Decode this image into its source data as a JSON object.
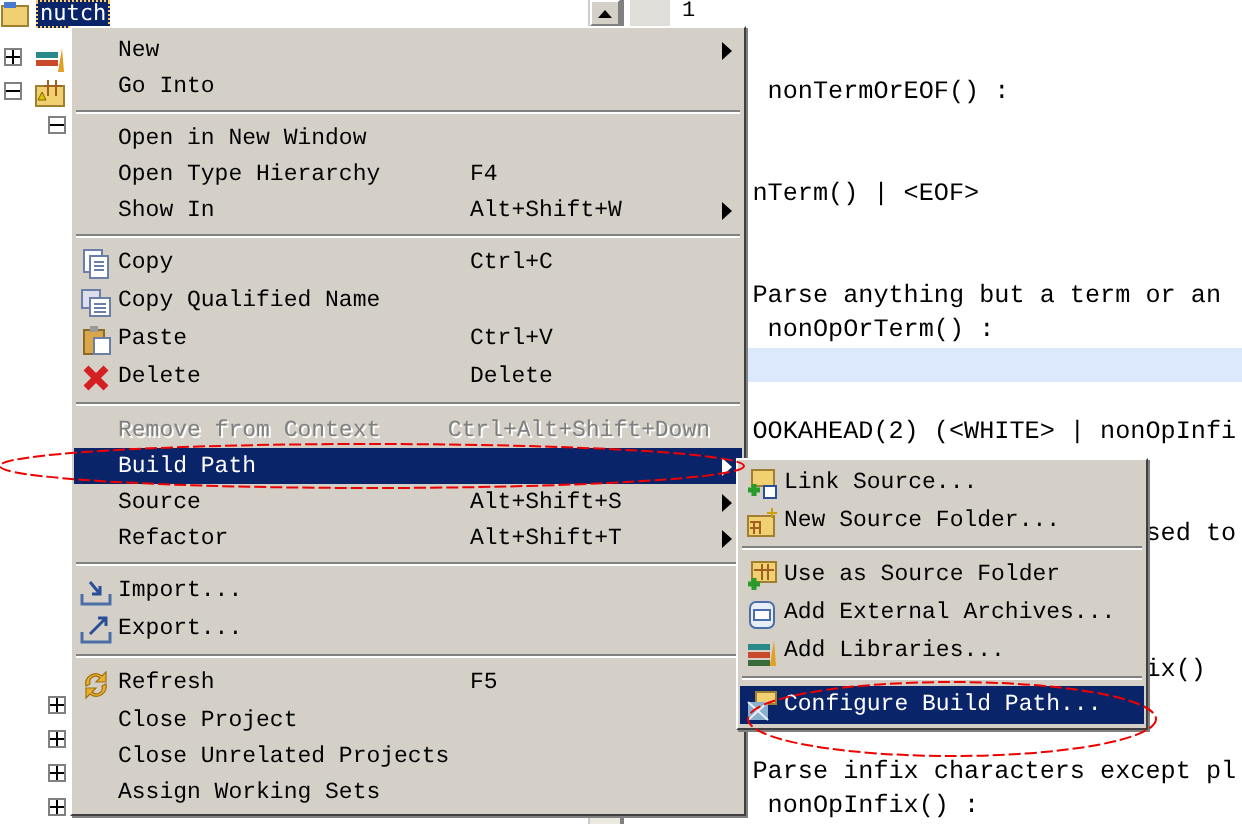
{
  "tree": {
    "items": [
      {
        "label": "nutch",
        "selected": true,
        "kind": "project"
      },
      {
        "kind": "library",
        "expanded": false
      },
      {
        "kind": "package",
        "expanded": true,
        "children": [
          {
            "expanded": true
          }
        ]
      }
    ],
    "lower_items": [
      {
        "expanded": false
      },
      {
        "expanded": false
      },
      {
        "expanded": false
      },
      {
        "expanded": false
      }
    ]
  },
  "editor": {
    "line_number": "1",
    "lines": [
      {
        "current": false
      },
      {
        "text": "     nonTermOrEOF() :",
        "current": false
      },
      {
        "current": false
      },
      {
        "current": false
      },
      {
        "text": "    nTerm() | <EOF>",
        "current": false
      },
      {
        "current": false
      },
      {
        "current": false
      },
      {
        "text": "    Parse anything but a term or an",
        "current": false
      },
      {
        "text": "     nonOpOrTerm() :",
        "current": false
      },
      {
        "current": true
      },
      {
        "current": false
      },
      {
        "text": "    OOKAHEAD(2) (<WHITE> | nonOpInfi",
        "current": false
      },
      {
        "current": false
      },
      {
        "current": false
      },
      {
        "text": "                              sed to",
        "current": false
      },
      {
        "current": false
      },
      {
        "current": false
      },
      {
        "current": false
      },
      {
        "text": "                              ix()",
        "current": false
      },
      {
        "current": false
      },
      {
        "current": false
      },
      {
        "text": "    Parse infix characters except pl",
        "current": false
      },
      {
        "text": "     nonOpInfix() :",
        "current": false
      }
    ]
  },
  "context_menu": {
    "groups": [
      [
        {
          "label": "New",
          "submenu": true,
          "disabled": false,
          "selected": false
        },
        {
          "label": "Go Into",
          "submenu": false,
          "disabled": false,
          "selected": false
        }
      ],
      [
        {
          "label": "Open in New Window",
          "submenu": false,
          "disabled": false,
          "selected": false
        },
        {
          "label": "Open Type Hierarchy",
          "shortcut": "F4",
          "submenu": false,
          "disabled": false,
          "selected": false
        },
        {
          "label": "Show In",
          "shortcut": "Alt+Shift+W",
          "submenu": true,
          "disabled": false,
          "selected": false
        }
      ],
      [
        {
          "label": "Copy",
          "shortcut": "Ctrl+C",
          "submenu": false,
          "disabled": false,
          "selected": false
        },
        {
          "label": "Copy Qualified Name",
          "submenu": false,
          "disabled": false,
          "selected": false
        },
        {
          "label": "Paste",
          "shortcut": "Ctrl+V",
          "submenu": false,
          "disabled": false,
          "selected": false
        },
        {
          "label": "Delete",
          "shortcut": "Delete",
          "submenu": false,
          "disabled": false,
          "selected": false
        }
      ],
      [
        {
          "label": "Remove from Context",
          "shortcut": "Ctrl+Alt+Shift+Down",
          "submenu": false,
          "disabled": true,
          "selected": false
        },
        {
          "label": "Build Path",
          "submenu": true,
          "disabled": false,
          "selected": true
        },
        {
          "label": "Source",
          "shortcut": "Alt+Shift+S",
          "submenu": true,
          "disabled": false,
          "selected": false
        },
        {
          "label": "Refactor",
          "shortcut": "Alt+Shift+T",
          "submenu": true,
          "disabled": false,
          "selected": false
        }
      ],
      [
        {
          "label": "Import...",
          "submenu": false,
          "disabled": false,
          "selected": false
        },
        {
          "label": "Export...",
          "submenu": false,
          "disabled": false,
          "selected": false
        }
      ],
      [
        {
          "label": "Refresh",
          "shortcut": "F5",
          "submenu": false,
          "disabled": false,
          "selected": false
        },
        {
          "label": "Close Project",
          "submenu": false,
          "disabled": false,
          "selected": false
        },
        {
          "label": "Close Unrelated Projects",
          "submenu": false,
          "disabled": false,
          "selected": false
        },
        {
          "label": "Assign Working Sets",
          "submenu": false,
          "disabled": false,
          "selected": false
        }
      ]
    ]
  },
  "build_path_menu": {
    "groups": [
      [
        {
          "label": "Link Source...",
          "selected": false
        },
        {
          "label": "New Source Folder...",
          "selected": false
        }
      ],
      [
        {
          "label": "Use as Source Folder",
          "selected": false
        },
        {
          "label": "Add External Archives...",
          "selected": false
        },
        {
          "label": "Add Libraries...",
          "selected": false
        }
      ],
      [
        {
          "label": "Configure Build Path...",
          "selected": true
        }
      ]
    ]
  }
}
